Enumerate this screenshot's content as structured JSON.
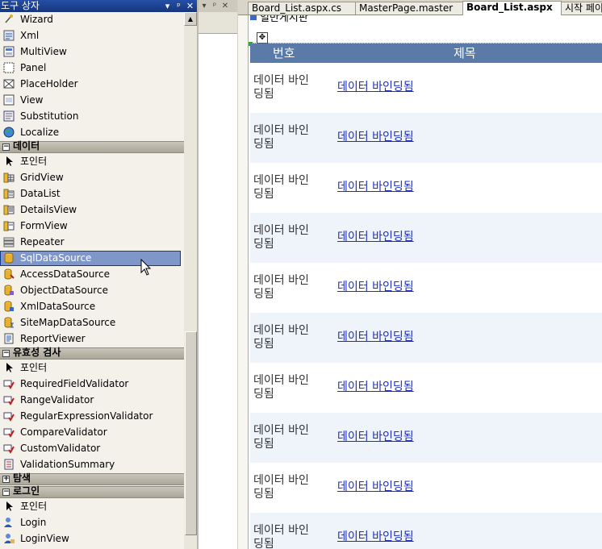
{
  "toolbox": {
    "title": "도구 상자",
    "controls": [
      "▾",
      "ᵖ",
      "✕"
    ],
    "groups": [
      {
        "type": "item",
        "label": "Wizard",
        "icon": "wizard-icon"
      },
      {
        "type": "item",
        "label": "Xml",
        "icon": "xml-icon"
      },
      {
        "type": "item",
        "label": "MultiView",
        "icon": "multiview-icon"
      },
      {
        "type": "item",
        "label": "Panel",
        "icon": "panel-icon"
      },
      {
        "type": "item",
        "label": "PlaceHolder",
        "icon": "placeholder-icon"
      },
      {
        "type": "item",
        "label": "View",
        "icon": "view-icon"
      },
      {
        "type": "item",
        "label": "Substitution",
        "icon": "substitution-icon"
      },
      {
        "type": "item",
        "label": "Localize",
        "icon": "localize-icon"
      }
    ],
    "categories": {
      "data": {
        "label": "데이터",
        "sign": "−"
      },
      "validation": {
        "label": "유효성 검사",
        "sign": "−"
      },
      "navigation": {
        "label": "탐색",
        "sign": "+"
      },
      "login": {
        "label": "로그인",
        "sign": "−"
      }
    },
    "data_items": [
      {
        "label": "포인터",
        "icon": "pointer-icon"
      },
      {
        "label": "GridView",
        "icon": "gridview-icon"
      },
      {
        "label": "DataList",
        "icon": "datalist-icon"
      },
      {
        "label": "DetailsView",
        "icon": "detailsview-icon"
      },
      {
        "label": "FormView",
        "icon": "formview-icon"
      },
      {
        "label": "Repeater",
        "icon": "repeater-icon"
      },
      {
        "label": "SqlDataSource",
        "icon": "sqldatasource-icon"
      },
      {
        "label": "AccessDataSource",
        "icon": "accessdatasource-icon"
      },
      {
        "label": "ObjectDataSource",
        "icon": "objectdatasource-icon"
      },
      {
        "label": "XmlDataSource",
        "icon": "xmldatasource-icon"
      },
      {
        "label": "SiteMapDataSource",
        "icon": "sitemapdatasource-icon"
      },
      {
        "label": "ReportViewer",
        "icon": "reportviewer-icon"
      }
    ],
    "validation_items": [
      {
        "label": "포인터",
        "icon": "pointer-icon"
      },
      {
        "label": "RequiredFieldValidator",
        "icon": "validator-icon"
      },
      {
        "label": "RangeValidator",
        "icon": "validator-icon"
      },
      {
        "label": "RegularExpressionValidator",
        "icon": "validator-icon"
      },
      {
        "label": "CompareValidator",
        "icon": "validator-icon"
      },
      {
        "label": "CustomValidator",
        "icon": "validator-icon"
      },
      {
        "label": "ValidationSummary",
        "icon": "validation-summary-icon"
      }
    ],
    "login_items": [
      {
        "label": "포인터",
        "icon": "pointer-icon"
      },
      {
        "label": "Login",
        "icon": "login-icon"
      },
      {
        "label": "LoginView",
        "icon": "loginview-icon"
      }
    ],
    "selected": "SqlDataSource"
  },
  "middle_panel": {
    "controls": [
      "▾",
      "ᵖ",
      "✕"
    ]
  },
  "editor": {
    "tabs": [
      {
        "label": "Board_List.aspx.cs",
        "active": false
      },
      {
        "label": "MasterPage.master",
        "active": false
      },
      {
        "label": "Board_List.aspx",
        "active": true
      },
      {
        "label": "시작 페이지",
        "active": false
      }
    ],
    "section_title": "일반게시판",
    "grid": {
      "headers": [
        "번호",
        "제목"
      ],
      "rows": [
        {
          "no": "데이터 바인딩됨",
          "title": "데이터 바인딩됨"
        },
        {
          "no": "데이터 바인딩됨",
          "title": "데이터 바인딩됨"
        },
        {
          "no": "데이터 바인딩됨",
          "title": "데이터 바인딩됨"
        },
        {
          "no": "데이터 바인딩됨",
          "title": "데이터 바인딩됨"
        },
        {
          "no": "데이터 바인딩됨",
          "title": "데이터 바인딩됨"
        },
        {
          "no": "데이터 바인딩됨",
          "title": "데이터 바인딩됨"
        },
        {
          "no": "데이터 바인딩됨",
          "title": "데이터 바인딩됨"
        },
        {
          "no": "데이터 바인딩됨",
          "title": "데이터 바인딩됨"
        },
        {
          "no": "데이터 바인딩됨",
          "title": "데이터 바인딩됨"
        },
        {
          "no": "데이터 바인딩됨",
          "title": "데이터 바인딩됨"
        }
      ]
    }
  }
}
